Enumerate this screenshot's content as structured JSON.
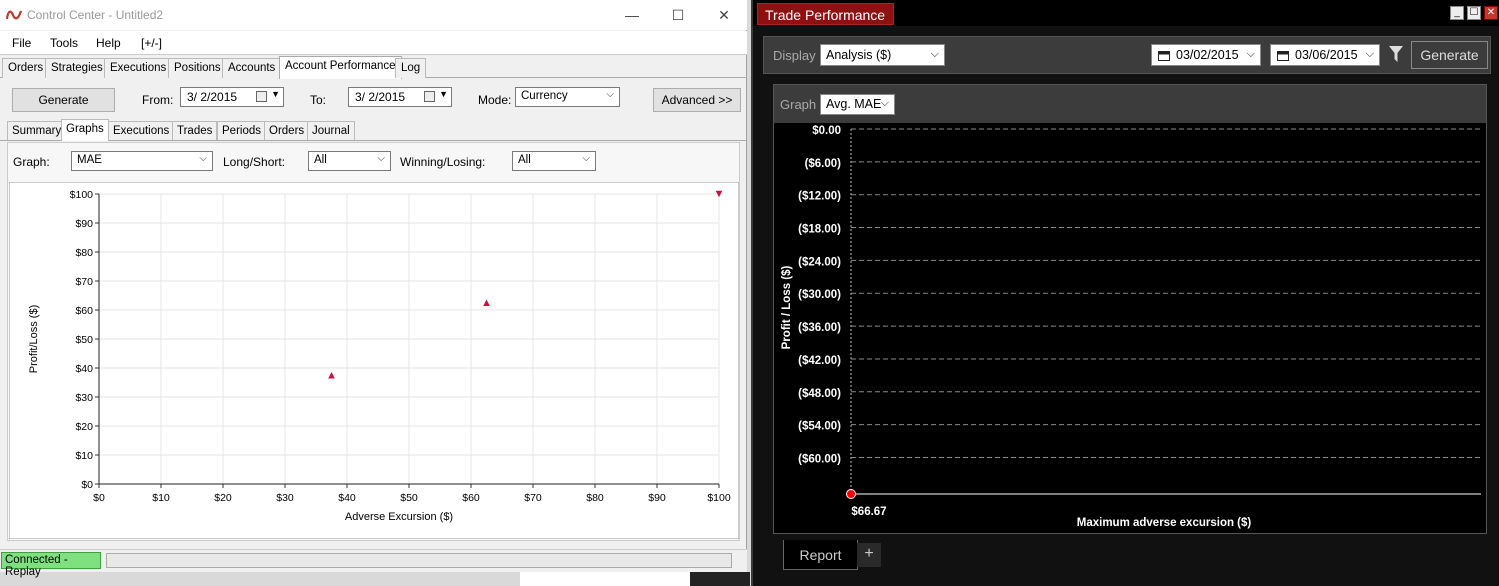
{
  "control_center": {
    "title": "Control Center - Untitled2",
    "window_controls": [
      "—",
      "☐",
      "✕"
    ],
    "menu": [
      "File",
      "Tools",
      "Help",
      "[+/-]"
    ],
    "tabs": [
      "Orders",
      "Strategies",
      "Executions",
      "Positions",
      "Accounts",
      "Account Performance",
      "Log"
    ],
    "active_tab": "Account Performance",
    "toolbar": {
      "generate_label": "Generate",
      "from_label": "From:",
      "from_value": "3/  2/2015",
      "to_label": "To:",
      "to_value": "3/  2/2015",
      "mode_label": "Mode:",
      "mode_value": "Currency",
      "advanced_label": "Advanced >>"
    },
    "subtabs": [
      "Summary",
      "Graphs",
      "Executions",
      "Trades",
      "Periods",
      "Orders",
      "Journal"
    ],
    "active_subtab": "Graphs",
    "graph_controls": {
      "graph_label": "Graph:",
      "graph_value": "MAE",
      "longshort_label": "Long/Short:",
      "longshort_value": "All",
      "winlose_label": "Winning/Losing:",
      "winlose_value": "All"
    },
    "status": {
      "connection": "Connected - Replay"
    }
  },
  "trade_performance": {
    "title": "Trade Performance",
    "window_controls": [
      "_",
      "☐",
      "✕"
    ],
    "display_label": "Display",
    "display_value": "Analysis ($)",
    "start_date": "03/02/2015",
    "end_date": "03/06/2015",
    "generate_label": "Generate",
    "graph_label": "Graph",
    "graph_value": "Avg. MAE",
    "bottom_tab": "Report",
    "add_tab": "+"
  },
  "chart_data": [
    {
      "type": "scatter",
      "xlabel": "Adverse Excursion ($)",
      "ylabel": "Profit/Loss ($)",
      "x_ticks": [
        "$0",
        "$10",
        "$20",
        "$30",
        "$40",
        "$50",
        "$60",
        "$70",
        "$80",
        "$90",
        "$100"
      ],
      "y_ticks": [
        "$0",
        "$10",
        "$20",
        "$30",
        "$40",
        "$50",
        "$60",
        "$70",
        "$80",
        "$90",
        "$100"
      ],
      "xlim": [
        0,
        100
      ],
      "ylim": [
        0,
        100
      ],
      "grid": true,
      "colors": {
        "marker": "#d0103a"
      },
      "points": [
        {
          "x": 37.5,
          "y": 37.5,
          "marker": "up"
        },
        {
          "x": 62.5,
          "y": 62.5,
          "marker": "up"
        },
        {
          "x": 100,
          "y": 100,
          "marker": "down"
        }
      ]
    },
    {
      "type": "scatter",
      "xlabel": "Maximum adverse excursion ($)",
      "ylabel": "Profit / Loss ($)",
      "y_ticks": [
        "$0.00",
        "($6.00)",
        "($12.00)",
        "($18.00)",
        "($24.00)",
        "($30.00)",
        "($36.00)",
        "($42.00)",
        "($48.00)",
        "($54.00)",
        "($60.00)"
      ],
      "ylim": [
        -66.67,
        0
      ],
      "grid": true,
      "colors": {
        "marker": "#ff0000"
      },
      "points": [
        {
          "x": 66.67,
          "y": -66.67,
          "label": "$66.67"
        }
      ]
    }
  ]
}
